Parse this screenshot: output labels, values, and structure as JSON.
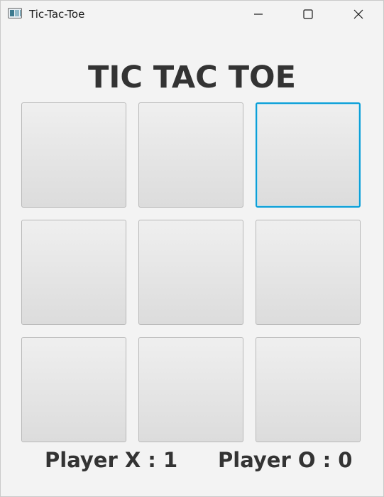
{
  "window": {
    "title": "Tic-Tac-Toe",
    "icon": "app-window-icon",
    "controls": {
      "minimize_icon": "minimize-icon",
      "maximize_icon": "maximize-icon",
      "close_icon": "close-icon"
    }
  },
  "game": {
    "heading": "TIC TAC TOE",
    "board": [
      [
        "",
        "",
        ""
      ],
      [
        "",
        "",
        ""
      ],
      [
        "",
        "",
        ""
      ]
    ],
    "focused_cell": "0-2",
    "score_x_label": "Player X : 1",
    "score_o_label": "Player O : 0"
  },
  "colors": {
    "focus_ring": "#0a9fd8",
    "text": "#333333",
    "background": "#f3f3f3"
  }
}
